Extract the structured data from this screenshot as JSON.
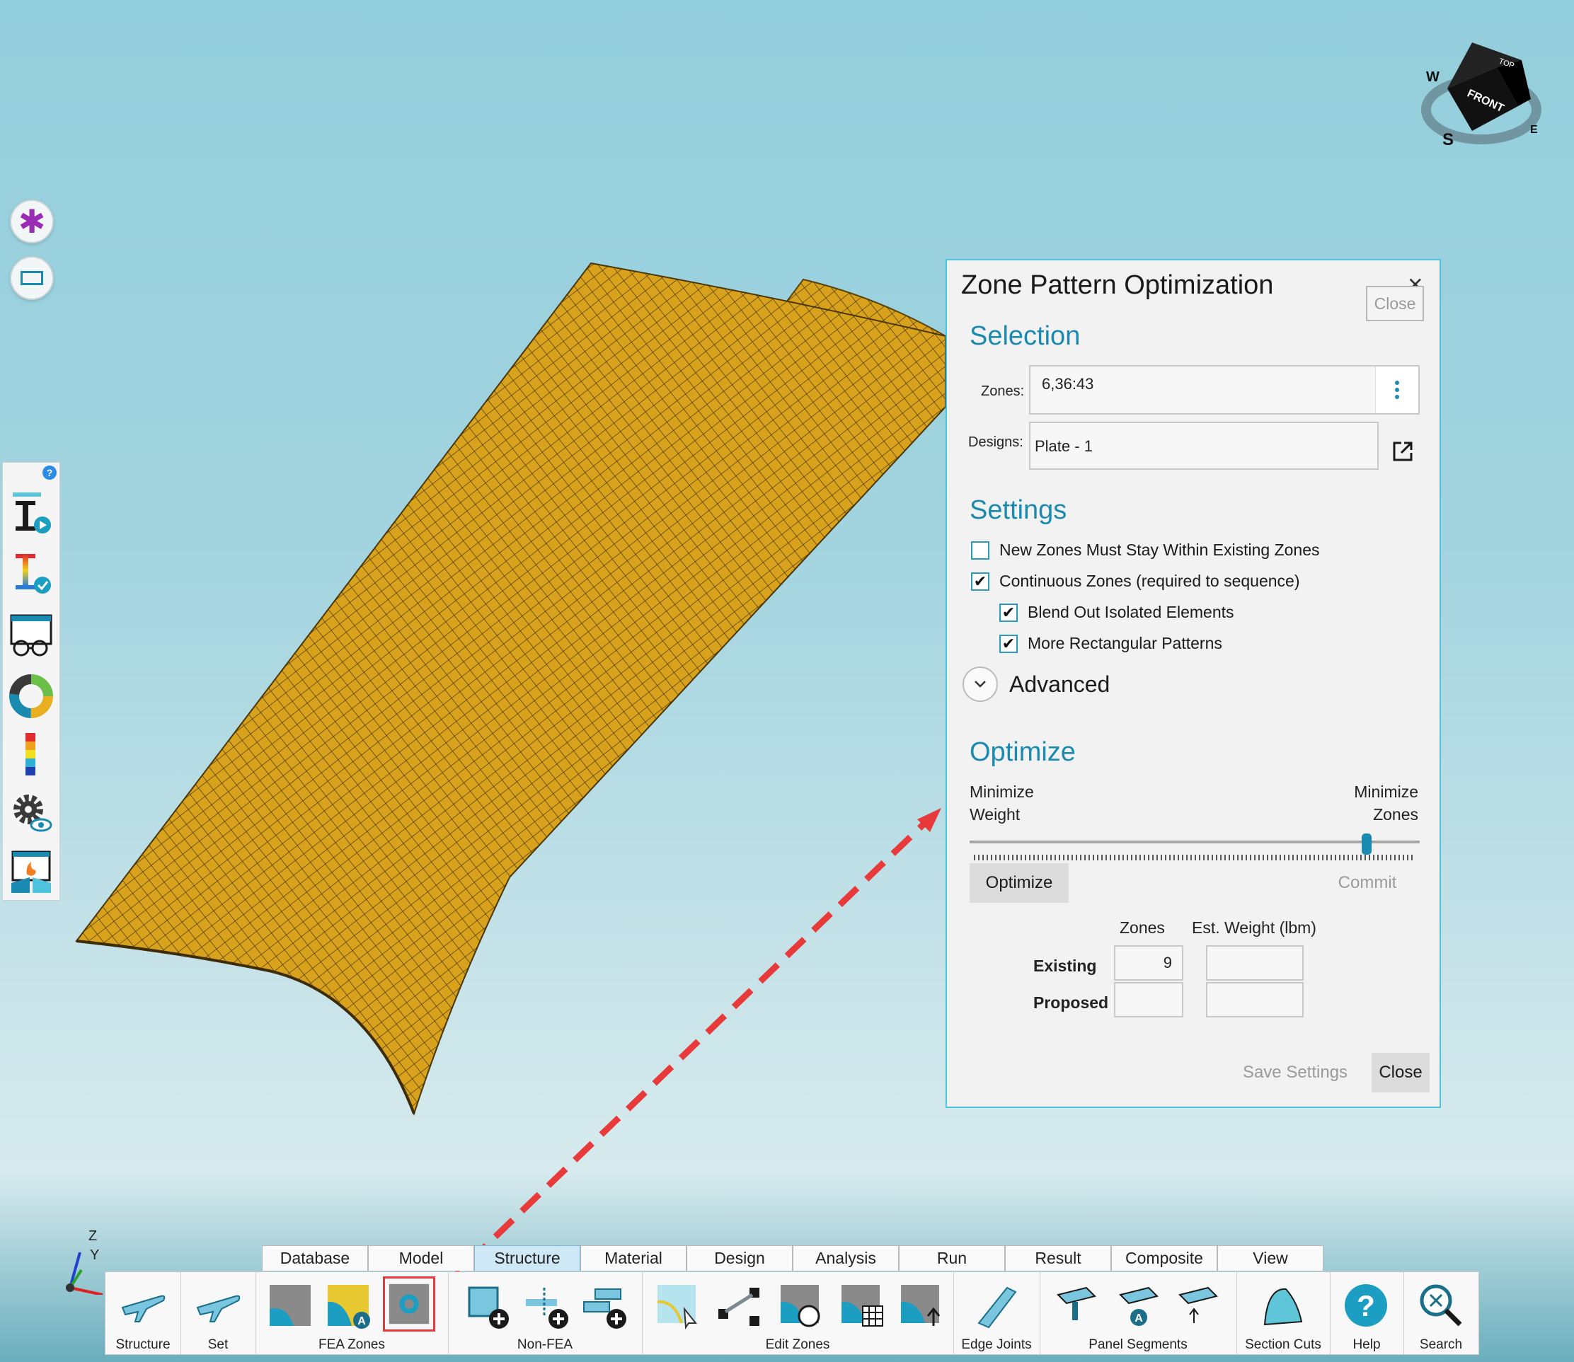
{
  "viewcube": {
    "face_front": "FRONT",
    "face_top": "TOP",
    "compass_w": "W",
    "compass_s": "S",
    "compass_e": "E"
  },
  "axes": {
    "z": "Z",
    "y": "Y"
  },
  "dialog": {
    "title": "Zone Pattern Optimization",
    "close_top": "Close",
    "selection": {
      "heading": "Selection",
      "zones_label": "Zones:",
      "zones_value": "6,36:43",
      "designs_label": "Designs:",
      "designs_value": "Plate - 1"
    },
    "settings": {
      "heading": "Settings",
      "options": [
        {
          "label": "New Zones Must Stay Within Existing Zones",
          "checked": false
        },
        {
          "label": "Continuous Zones (required to sequence)",
          "checked": true
        },
        {
          "label": "Blend Out Isolated Elements",
          "checked": true
        },
        {
          "label": "More Rectangular Patterns",
          "checked": true
        }
      ],
      "advanced": "Advanced"
    },
    "optimize": {
      "heading": "Optimize",
      "left_label_1": "Minimize",
      "left_label_2": "Weight",
      "right_label_1": "Minimize",
      "right_label_2": "Zones",
      "slider_value": 0.89,
      "optimize_button": "Optimize",
      "commit_button": "Commit",
      "col_zones": "Zones",
      "col_weight": "Est. Weight (lbm)",
      "row_existing": "Existing",
      "row_proposed": "Proposed",
      "existing_zones": "9",
      "existing_weight": "",
      "proposed_zones": "",
      "proposed_weight": ""
    },
    "save_settings": "Save Settings",
    "close_bottom": "Close"
  },
  "ribbon": {
    "tabs": [
      "Database",
      "Model",
      "Structure",
      "Material",
      "Design",
      "Analysis",
      "Run",
      "Result",
      "Composite",
      "View"
    ],
    "active_tab": "Structure",
    "groups": {
      "structure": "Structure",
      "set": "Set",
      "fea_zones": "FEA Zones",
      "non_fea": "Non-FEA",
      "edit_zones": "Edit Zones",
      "edge_joints": "Edge Joints",
      "panel_segments": "Panel Segments",
      "section_cuts": "Section Cuts",
      "help": "Help",
      "search": "Search"
    }
  },
  "colors": {
    "accent": "#1b8ab0",
    "mesh": "#d8a21c",
    "arrow": "#e83a3a",
    "dialog_border": "#4fc3dc"
  }
}
